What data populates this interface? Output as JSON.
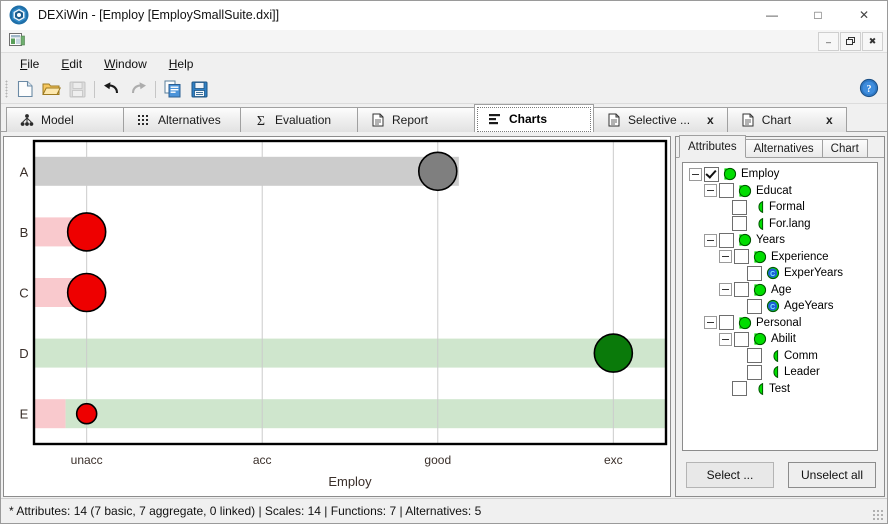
{
  "window": {
    "title": "DEXiWin - [Employ [EmploySmallSuite.dxi]]",
    "app_icon": "dexi-logo-icon",
    "minimize": "—",
    "maximize": "□",
    "close": "✕",
    "mdi": {
      "icon": "document-window-icon",
      "minimize": "–",
      "restore": "❐",
      "close": "✖"
    }
  },
  "menu": [
    {
      "label": "File",
      "accel": "F"
    },
    {
      "label": "Edit",
      "accel": "E"
    },
    {
      "label": "Window",
      "accel": "W"
    },
    {
      "label": "Help",
      "accel": "H"
    }
  ],
  "toolbar": {
    "buttons": [
      {
        "name": "new-file-icon",
        "enabled": true
      },
      {
        "name": "open-folder-icon",
        "enabled": true
      },
      {
        "name": "save-icon",
        "enabled": false
      },
      {
        "name": "separator"
      },
      {
        "name": "undo-icon",
        "enabled": true
      },
      {
        "name": "redo-icon",
        "enabled": false
      },
      {
        "name": "separator"
      },
      {
        "name": "copy-icon",
        "enabled": true
      },
      {
        "name": "save-report-icon",
        "enabled": true
      }
    ],
    "help_icon": "help-question-icon"
  },
  "main_tabs": [
    {
      "label": "Model",
      "icon": "model-tree-icon",
      "active": false,
      "closable": false
    },
    {
      "label": "Alternatives",
      "icon": "grid-dots-icon",
      "active": false,
      "closable": false
    },
    {
      "label": "Evaluation",
      "icon": "sigma-icon",
      "active": false,
      "closable": false
    },
    {
      "label": "Report",
      "icon": "document-icon",
      "active": false,
      "closable": false
    },
    {
      "label": "Charts",
      "icon": "bar-chart-icon",
      "active": true,
      "closable": false
    },
    {
      "label": "Selective ...",
      "icon": "document-icon",
      "active": false,
      "closable": true,
      "close_label": "x"
    },
    {
      "label": "Chart",
      "icon": "document-icon",
      "active": false,
      "closable": true,
      "close_label": "x"
    }
  ],
  "side_panel": {
    "tabs": [
      {
        "label": "Attributes",
        "active": true
      },
      {
        "label": "Alternatives",
        "active": false
      },
      {
        "label": "Chart",
        "active": false
      }
    ],
    "tree": [
      {
        "label": "Employ",
        "depth": 0,
        "expander": true,
        "checkbox": true,
        "checked": true,
        "icon": "aggregate-attribute-icon"
      },
      {
        "label": "Educat",
        "depth": 1,
        "expander": true,
        "checkbox": true,
        "checked": false,
        "icon": "aggregate-attribute-icon"
      },
      {
        "label": "Formal",
        "depth": 2,
        "expander": false,
        "checkbox": true,
        "checked": false,
        "icon": "basic-attribute-icon"
      },
      {
        "label": "For.lang",
        "depth": 2,
        "expander": false,
        "checkbox": true,
        "checked": false,
        "icon": "basic-attribute-icon"
      },
      {
        "label": "Years",
        "depth": 1,
        "expander": true,
        "checkbox": true,
        "checked": false,
        "icon": "aggregate-attribute-icon"
      },
      {
        "label": "Experience",
        "depth": 2,
        "expander": true,
        "checkbox": true,
        "checked": false,
        "icon": "aggregate-attribute-icon"
      },
      {
        "label": "ExperYears",
        "depth": 3,
        "expander": false,
        "checkbox": true,
        "checked": false,
        "icon": "continuous-attribute-icon"
      },
      {
        "label": "Age",
        "depth": 2,
        "expander": true,
        "checkbox": true,
        "checked": false,
        "icon": "aggregate-attribute-icon"
      },
      {
        "label": "AgeYears",
        "depth": 3,
        "expander": false,
        "checkbox": true,
        "checked": false,
        "icon": "continuous-attribute-icon"
      },
      {
        "label": "Personal",
        "depth": 1,
        "expander": true,
        "checkbox": true,
        "checked": false,
        "icon": "aggregate-attribute-icon"
      },
      {
        "label": "Abilit",
        "depth": 2,
        "expander": true,
        "checkbox": true,
        "checked": false,
        "icon": "aggregate-attribute-icon"
      },
      {
        "label": "Comm",
        "depth": 3,
        "expander": false,
        "checkbox": true,
        "checked": false,
        "icon": "basic-attribute-icon"
      },
      {
        "label": "Leader",
        "depth": 3,
        "expander": false,
        "checkbox": true,
        "checked": false,
        "icon": "basic-attribute-icon"
      },
      {
        "label": "Test",
        "depth": 2,
        "expander": false,
        "checkbox": true,
        "checked": false,
        "icon": "basic-attribute-icon"
      }
    ],
    "buttons": {
      "select": "Select ...",
      "unselect_all": "Unselect all"
    }
  },
  "statusbar": {
    "text": "* Attributes: 14 (7 basic, 7 aggregate, 0 linked)  |  Scales: 14  |  Functions: 7  |  Alternatives: 5"
  },
  "chart_data": {
    "type": "scatter",
    "title": "",
    "xlabel": "Employ",
    "ylabel": "",
    "x_ticks": [
      "unacc",
      "acc",
      "good",
      "exc"
    ],
    "x_tick_values": [
      1,
      2,
      3,
      4
    ],
    "xlim": [
      0.7,
      4.3
    ],
    "categories": [
      "A",
      "B",
      "C",
      "D",
      "E"
    ],
    "grid": "vertical",
    "legend": "none",
    "colors": {
      "bad": "#f9c9cd",
      "neutral": "#cccccc",
      "good": "#cfe6cd",
      "marker_bad": "#ee0000",
      "marker_neutral": "#7f7f7f",
      "marker_good": "#0a7a0a",
      "marker_outline": "#000000",
      "axis": "#000000",
      "gridline": "#cccccc"
    },
    "points": [
      {
        "alternative": "A",
        "value": 3,
        "value_label": "good",
        "marker_color": "#7f7f7f",
        "radius": 19
      },
      {
        "alternative": "B",
        "value": 1,
        "value_label": "unacc",
        "marker_color": "#ee0000",
        "radius": 19
      },
      {
        "alternative": "C",
        "value": 1,
        "value_label": "unacc",
        "marker_color": "#ee0000",
        "radius": 19
      },
      {
        "alternative": "D",
        "value": 4,
        "value_label": "exc",
        "marker_color": "#0a7a0a",
        "radius": 19
      },
      {
        "alternative": "E",
        "value": 1,
        "value_label": "unacc",
        "marker_color": "#ee0000",
        "radius": 10
      }
    ],
    "bands": [
      {
        "alternative": "A",
        "segments": [
          {
            "from": 0.7,
            "to": 3.12,
            "color": "#cccccc"
          }
        ]
      },
      {
        "alternative": "B",
        "segments": [
          {
            "from": 0.7,
            "to": 1.08,
            "color": "#f9c9cd"
          }
        ]
      },
      {
        "alternative": "C",
        "segments": [
          {
            "from": 0.7,
            "to": 1.08,
            "color": "#f9c9cd"
          }
        ]
      },
      {
        "alternative": "D",
        "segments": [
          {
            "from": 0.7,
            "to": 4.3,
            "color": "#cfe6cd"
          }
        ]
      },
      {
        "alternative": "E",
        "segments": [
          {
            "from": 0.7,
            "to": 0.88,
            "color": "#f9c9cd"
          },
          {
            "from": 0.88,
            "to": 4.3,
            "color": "#cfe6cd"
          }
        ]
      }
    ]
  }
}
